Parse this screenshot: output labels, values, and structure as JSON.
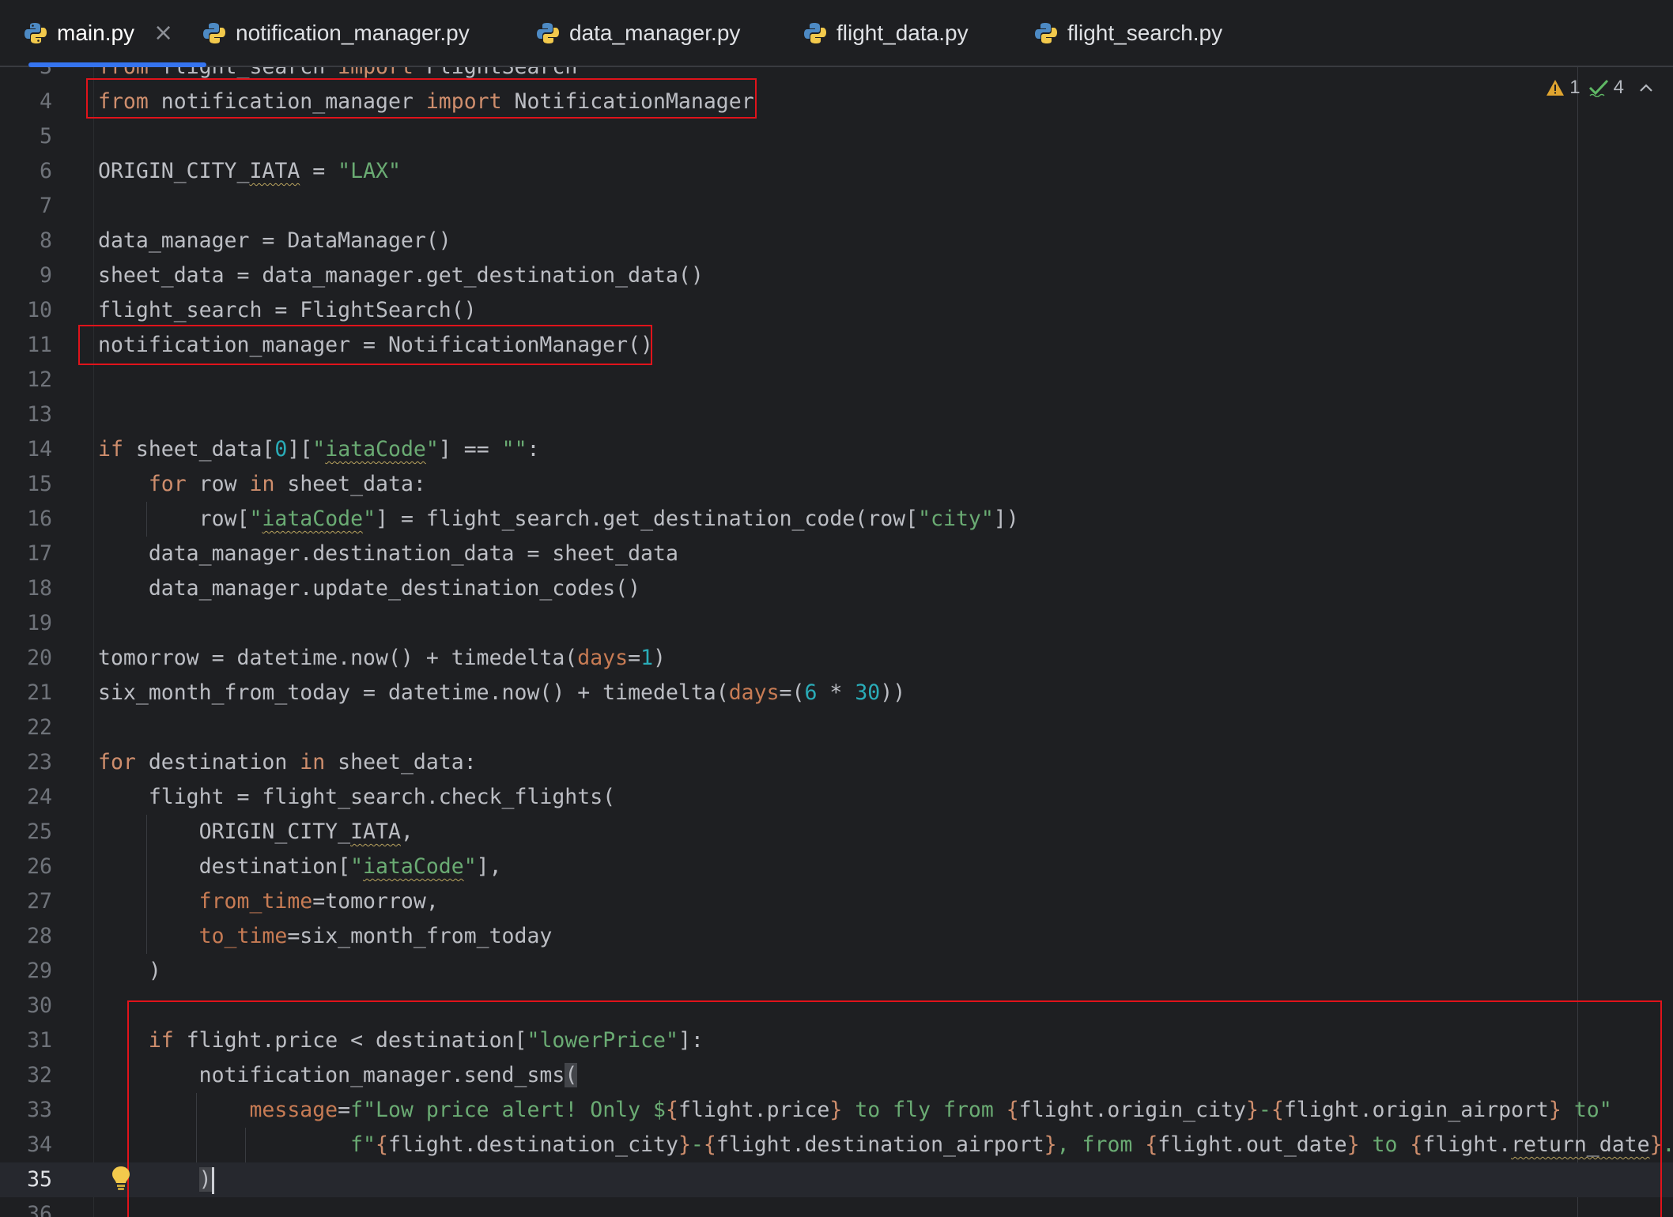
{
  "tabs": [
    {
      "label": "main.py",
      "active": true,
      "closable": true,
      "close_glyph": "×"
    },
    {
      "label": "notification_manager.py",
      "active": false
    },
    {
      "label": "data_manager.py",
      "active": false
    },
    {
      "label": "flight_data.py",
      "active": false
    },
    {
      "label": "flight_search.py",
      "active": false
    }
  ],
  "inspections": {
    "warnings": "1",
    "checks": "4"
  },
  "colors": {
    "keyword": "#cf8e6d",
    "string": "#6aab73",
    "number": "#2aacb8",
    "param": "#c77b54",
    "highlight_box": "#e0131b",
    "tab_underline": "#3574f0"
  },
  "editor": {
    "current_line": "35",
    "lines": [
      {
        "n": "3",
        "t": "from flight_search import FlightSearch"
      },
      {
        "n": "4",
        "t": "from notification_manager import NotificationManager"
      },
      {
        "n": "5",
        "t": ""
      },
      {
        "n": "6",
        "t": "ORIGIN_CITY_IATA = \"LAX\""
      },
      {
        "n": "7",
        "t": ""
      },
      {
        "n": "8",
        "t": "data_manager = DataManager()"
      },
      {
        "n": "9",
        "t": "sheet_data = data_manager.get_destination_data()"
      },
      {
        "n": "10",
        "t": "flight_search = FlightSearch()"
      },
      {
        "n": "11",
        "t": "notification_manager = NotificationManager()"
      },
      {
        "n": "12",
        "t": ""
      },
      {
        "n": "13",
        "t": ""
      },
      {
        "n": "14",
        "t": "if sheet_data[0][\"iataCode\"] == \"\":"
      },
      {
        "n": "15",
        "t": "    for row in sheet_data:"
      },
      {
        "n": "16",
        "t": "        row[\"iataCode\"] = flight_search.get_destination_code(row[\"city\"])"
      },
      {
        "n": "17",
        "t": "    data_manager.destination_data = sheet_data"
      },
      {
        "n": "18",
        "t": "    data_manager.update_destination_codes()"
      },
      {
        "n": "19",
        "t": ""
      },
      {
        "n": "20",
        "t": "tomorrow = datetime.now() + timedelta(days=1)"
      },
      {
        "n": "21",
        "t": "six_month_from_today = datetime.now() + timedelta(days=(6 * 30))"
      },
      {
        "n": "22",
        "t": ""
      },
      {
        "n": "23",
        "t": "for destination in sheet_data:"
      },
      {
        "n": "24",
        "t": "    flight = flight_search.check_flights("
      },
      {
        "n": "25",
        "t": "        ORIGIN_CITY_IATA,"
      },
      {
        "n": "26",
        "t": "        destination[\"iataCode\"],"
      },
      {
        "n": "27",
        "t": "        from_time=tomorrow,"
      },
      {
        "n": "28",
        "t": "        to_time=six_month_from_today"
      },
      {
        "n": "29",
        "t": "    )"
      },
      {
        "n": "30",
        "t": ""
      },
      {
        "n": "31",
        "t": "    if flight.price < destination[\"lowerPrice\"]:"
      },
      {
        "n": "32",
        "t": "        notification_manager.send_sms("
      },
      {
        "n": "33",
        "t": "            message=f\"Low price alert! Only ${flight.price} to fly from {flight.origin_city}-{flight.origin_airport} to\""
      },
      {
        "n": "34",
        "t": "                    f\"{flight.destination_city}-{flight.destination_airport}, from {flight.out_date} to {flight.return_date}.\""
      },
      {
        "n": "35",
        "t": "        )"
      },
      {
        "n": "36",
        "t": ""
      }
    ]
  }
}
